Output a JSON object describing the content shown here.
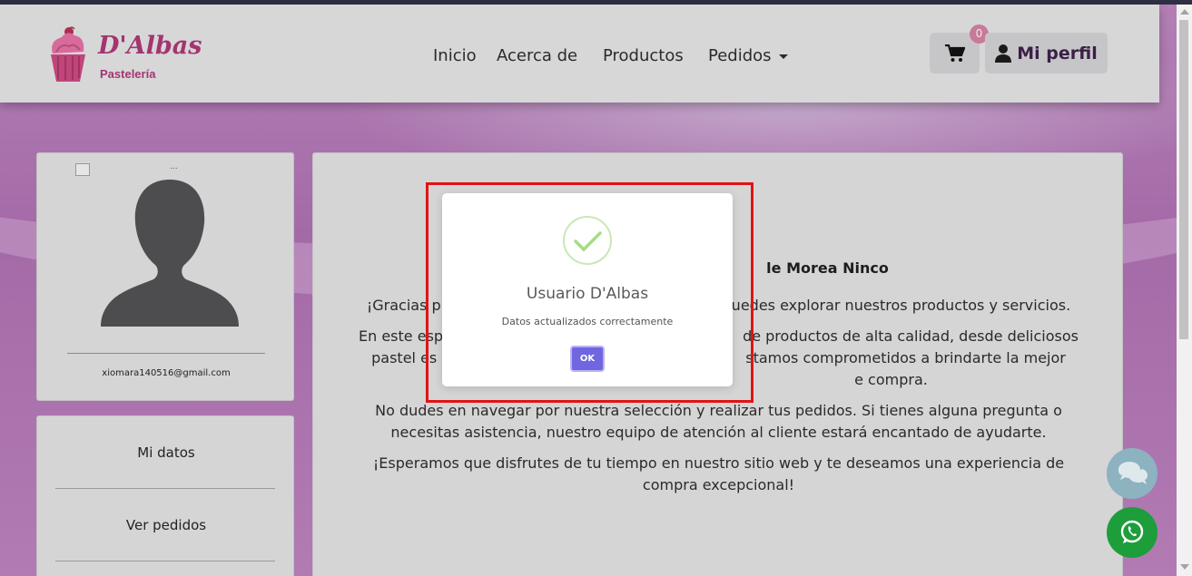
{
  "brand": {
    "name": "D'Albas",
    "subtitle": "Pastelería"
  },
  "nav": {
    "links": [
      "Inicio",
      "Acerca de",
      "Productos",
      "Pedidos"
    ],
    "cart_count": "0",
    "profile_label": "Mi perfil"
  },
  "profile": {
    "image_alt": "...",
    "email": "xiomara140516@gmail.com"
  },
  "sidebar": {
    "items": [
      "Mi datos",
      "Ver pedidos"
    ]
  },
  "main": {
    "title_partial": "le Morea Ninco",
    "paragraphs": [
      [
        "¡Gracias p",
        "uedes explorar nuestros productos y servicios."
      ],
      [
        "En este esp",
        "de productos de alta calidad, desde deliciosos"
      ],
      [
        "pastel es",
        "stamos comprometidos a brindarte la mejor"
      ],
      [
        "e compra."
      ],
      [
        "No dudes en navegar por nuestra selección y realizar tus pedidos. Si tienes alguna pregunta o"
      ],
      [
        "necesitas asistencia, nuestro equipo de atención al cliente estará encantado de ayudarte."
      ],
      [
        "¡Esperamos que disfrutes de tu tiempo en nuestro sitio web y te deseamos una experiencia de"
      ],
      [
        "compra excepcional!"
      ]
    ]
  },
  "dialog": {
    "title": "Usuario D'Albas",
    "message": "Datos actualizados correctamente",
    "ok_label": "OK",
    "icon": "success-check-icon"
  },
  "colors": {
    "brand": "#a3356f",
    "ok_button": "#7066e0",
    "whatsapp": "#1d9e3b",
    "highlight": "#e01414"
  }
}
